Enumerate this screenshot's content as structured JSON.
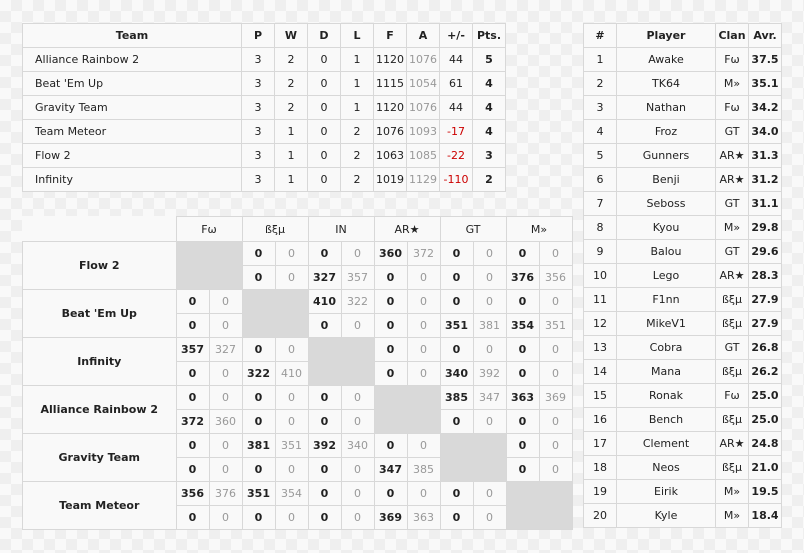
{
  "standings": {
    "headers": [
      "Team",
      "P",
      "W",
      "D",
      "L",
      "F",
      "A",
      "+/-",
      "Pts."
    ],
    "rows": [
      {
        "team": "Alliance Rainbow 2",
        "p": "3",
        "w": "2",
        "d": "0",
        "l": "1",
        "f": "1120",
        "a": "1076",
        "diff": "44",
        "pts": "5",
        "negative": false
      },
      {
        "team": "Beat 'Em Up",
        "p": "3",
        "w": "2",
        "d": "0",
        "l": "1",
        "f": "1115",
        "a": "1054",
        "diff": "61",
        "pts": "4",
        "negative": false
      },
      {
        "team": "Gravity Team",
        "p": "3",
        "w": "2",
        "d": "0",
        "l": "1",
        "f": "1120",
        "a": "1076",
        "diff": "44",
        "pts": "4",
        "negative": false
      },
      {
        "team": "Team Meteor",
        "p": "3",
        "w": "1",
        "d": "0",
        "l": "2",
        "f": "1076",
        "a": "1093",
        "diff": "-17",
        "pts": "4",
        "negative": true
      },
      {
        "team": "Flow 2",
        "p": "3",
        "w": "1",
        "d": "0",
        "l": "2",
        "f": "1063",
        "a": "1085",
        "diff": "-22",
        "pts": "3",
        "negative": true
      },
      {
        "team": "Infinity",
        "p": "3",
        "w": "1",
        "d": "0",
        "l": "2",
        "f": "1019",
        "a": "1129",
        "diff": "-110",
        "pts": "2",
        "negative": true
      }
    ]
  },
  "players": {
    "headers": [
      "#",
      "Player",
      "Clan",
      "Avr."
    ],
    "rows": [
      {
        "rank": "1",
        "name": "Awake",
        "clan": "Fω",
        "avr": "37.5"
      },
      {
        "rank": "2",
        "name": "TK64",
        "clan": "M»",
        "avr": "35.1"
      },
      {
        "rank": "3",
        "name": "Nathan",
        "clan": "Fω",
        "avr": "34.2"
      },
      {
        "rank": "4",
        "name": "Froz",
        "clan": "GT",
        "avr": "34.0"
      },
      {
        "rank": "5",
        "name": "Gunners",
        "clan": "AR★",
        "avr": "31.3"
      },
      {
        "rank": "6",
        "name": "Benji",
        "clan": "AR★",
        "avr": "31.2"
      },
      {
        "rank": "7",
        "name": "Seboss",
        "clan": "GT",
        "avr": "31.1"
      },
      {
        "rank": "8",
        "name": "Kyou",
        "clan": "M»",
        "avr": "29.8"
      },
      {
        "rank": "9",
        "name": "Balou",
        "clan": "GT",
        "avr": "29.6"
      },
      {
        "rank": "10",
        "name": "Lego",
        "clan": "AR★",
        "avr": "28.3"
      },
      {
        "rank": "11",
        "name": "F1nn",
        "clan": "ßξμ",
        "avr": "27.9"
      },
      {
        "rank": "12",
        "name": "MikeV1",
        "clan": "ßξμ",
        "avr": "27.9"
      },
      {
        "rank": "13",
        "name": "Cobra",
        "clan": "GT",
        "avr": "26.8"
      },
      {
        "rank": "14",
        "name": "Mana",
        "clan": "ßξμ",
        "avr": "26.2"
      },
      {
        "rank": "15",
        "name": "Ronak",
        "clan": "Fω",
        "avr": "25.0"
      },
      {
        "rank": "16",
        "name": "Bench",
        "clan": "ßξμ",
        "avr": "25.0"
      },
      {
        "rank": "17",
        "name": "Clement",
        "clan": "AR★",
        "avr": "24.8"
      },
      {
        "rank": "18",
        "name": "Neos",
        "clan": "ßξμ",
        "avr": "21.0"
      },
      {
        "rank": "19",
        "name": "Eirik",
        "clan": "M»",
        "avr": "19.5"
      },
      {
        "rank": "20",
        "name": "Kyle",
        "clan": "M»",
        "avr": "18.4"
      }
    ]
  },
  "matrix": {
    "columns": [
      "Fω",
      "ßξμ",
      "IN",
      "AR★",
      "GT",
      "M»"
    ],
    "rows": [
      {
        "team": "Flow 2",
        "self": 0,
        "legs": [
          [
            null,
            [
              "0",
              "0"
            ],
            [
              "0",
              "0"
            ],
            [
              "360",
              "372"
            ],
            [
              "0",
              "0"
            ],
            [
              "0",
              "0"
            ]
          ],
          [
            null,
            [
              "0",
              "0"
            ],
            [
              "327",
              "357"
            ],
            [
              "0",
              "0"
            ],
            [
              "0",
              "0"
            ],
            [
              "376",
              "356"
            ]
          ]
        ]
      },
      {
        "team": "Beat 'Em Up",
        "self": 1,
        "legs": [
          [
            [
              "0",
              "0"
            ],
            null,
            [
              "410",
              "322"
            ],
            [
              "0",
              "0"
            ],
            [
              "0",
              "0"
            ],
            [
              "0",
              "0"
            ]
          ],
          [
            [
              "0",
              "0"
            ],
            null,
            [
              "0",
              "0"
            ],
            [
              "0",
              "0"
            ],
            [
              "351",
              "381"
            ],
            [
              "354",
              "351"
            ]
          ]
        ]
      },
      {
        "team": "Infinity",
        "self": 2,
        "legs": [
          [
            [
              "357",
              "327"
            ],
            [
              "0",
              "0"
            ],
            null,
            [
              "0",
              "0"
            ],
            [
              "0",
              "0"
            ],
            [
              "0",
              "0"
            ]
          ],
          [
            [
              "0",
              "0"
            ],
            [
              "322",
              "410"
            ],
            null,
            [
              "0",
              "0"
            ],
            [
              "340",
              "392"
            ],
            [
              "0",
              "0"
            ]
          ]
        ]
      },
      {
        "team": "Alliance Rainbow 2",
        "self": 3,
        "legs": [
          [
            [
              "0",
              "0"
            ],
            [
              "0",
              "0"
            ],
            [
              "0",
              "0"
            ],
            null,
            [
              "385",
              "347"
            ],
            [
              "363",
              "369"
            ]
          ],
          [
            [
              "372",
              "360"
            ],
            [
              "0",
              "0"
            ],
            [
              "0",
              "0"
            ],
            null,
            [
              "0",
              "0"
            ],
            [
              "0",
              "0"
            ]
          ]
        ]
      },
      {
        "team": "Gravity Team",
        "self": 4,
        "legs": [
          [
            [
              "0",
              "0"
            ],
            [
              "381",
              "351"
            ],
            [
              "392",
              "340"
            ],
            [
              "0",
              "0"
            ],
            null,
            [
              "0",
              "0"
            ]
          ],
          [
            [
              "0",
              "0"
            ],
            [
              "0",
              "0"
            ],
            [
              "0",
              "0"
            ],
            [
              "347",
              "385"
            ],
            null,
            [
              "0",
              "0"
            ]
          ]
        ]
      },
      {
        "team": "Team Meteor",
        "self": 5,
        "legs": [
          [
            [
              "356",
              "376"
            ],
            [
              "351",
              "354"
            ],
            [
              "0",
              "0"
            ],
            [
              "0",
              "0"
            ],
            [
              "0",
              "0"
            ],
            null
          ],
          [
            [
              "0",
              "0"
            ],
            [
              "0",
              "0"
            ],
            [
              "0",
              "0"
            ],
            [
              "369",
              "363"
            ],
            [
              "0",
              "0"
            ],
            null
          ]
        ]
      }
    ]
  }
}
